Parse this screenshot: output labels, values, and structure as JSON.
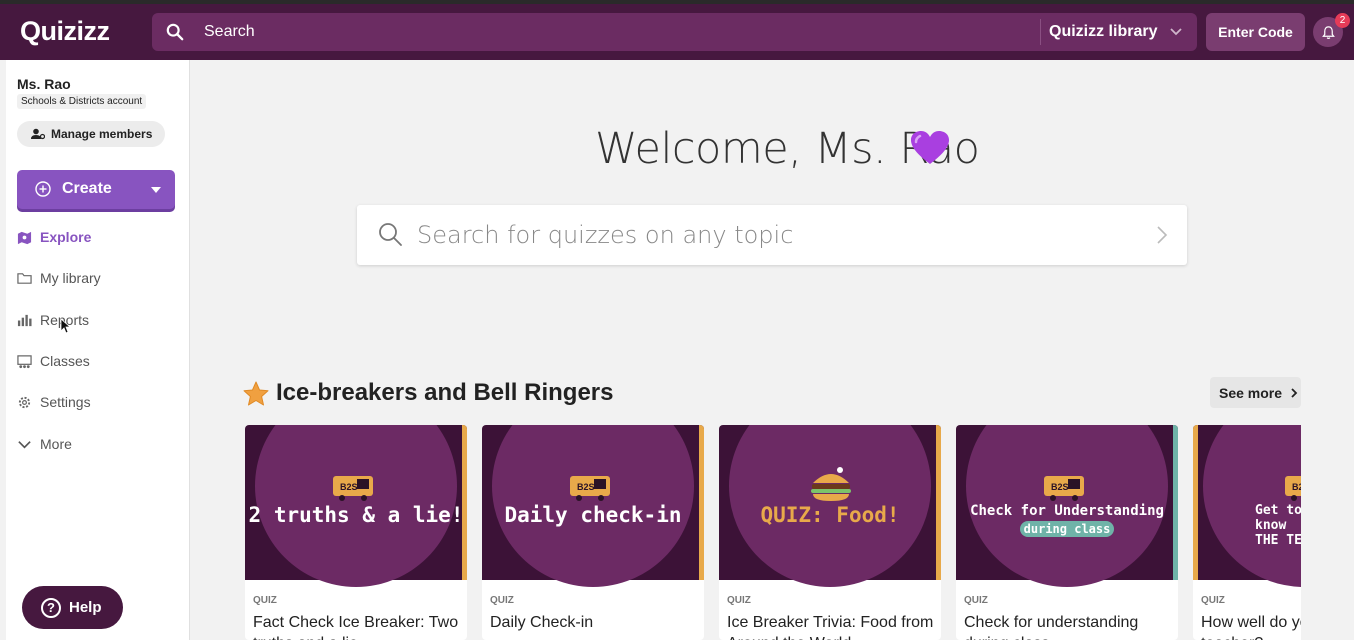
{
  "topbar": {
    "logo": "Quizizz",
    "search_placeholder": "Search",
    "library_label": "Quizizz library",
    "enter_code_label": "Enter Code",
    "notification_count": "2"
  },
  "sidebar": {
    "user_name": "Ms. Rao",
    "account_type": "Schools & Districts account",
    "manage_members_label": "Manage members",
    "create_label": "Create",
    "items": [
      {
        "label": "Explore",
        "icon": "explore-icon",
        "active": true
      },
      {
        "label": "My library",
        "icon": "folder-icon",
        "active": false
      },
      {
        "label": "Reports",
        "icon": "reports-icon",
        "active": false
      },
      {
        "label": "Classes",
        "icon": "classes-icon",
        "active": false
      },
      {
        "label": "Settings",
        "icon": "gear-icon",
        "active": false
      },
      {
        "label": "More",
        "icon": "chevron-down-icon",
        "active": false
      }
    ],
    "help_label": "Help"
  },
  "main": {
    "welcome": "Welcome, Ms. Rao",
    "search_placeholder": "Search for quizzes on any topic",
    "section_title": "Ice-breakers and Bell Ringers",
    "see_more_label": "See more",
    "cards": [
      {
        "thumb_text": "2 truths & a lie!",
        "kind": "QUIZ",
        "title": "Fact Check Ice Breaker: Two truths and a lie"
      },
      {
        "thumb_text": "Daily check-in",
        "kind": "QUIZ",
        "title": "Daily Check-in"
      },
      {
        "thumb_text": "QUIZ: Food!",
        "kind": "QUIZ",
        "title": "Ice Breaker Trivia: Food from Around the World"
      },
      {
        "thumb_text": "Check for Understanding",
        "thumb_subtext": "during class",
        "kind": "QUIZ",
        "title": "Check for understanding during class"
      },
      {
        "thumb_text": "Get to know THE TE",
        "kind": "QUIZ",
        "title": "How well do you know your teacher?"
      }
    ]
  },
  "colors": {
    "topbar": "#46183f",
    "accent": "#8854c0",
    "badge": "#e53b58",
    "star": "#f0a040"
  }
}
